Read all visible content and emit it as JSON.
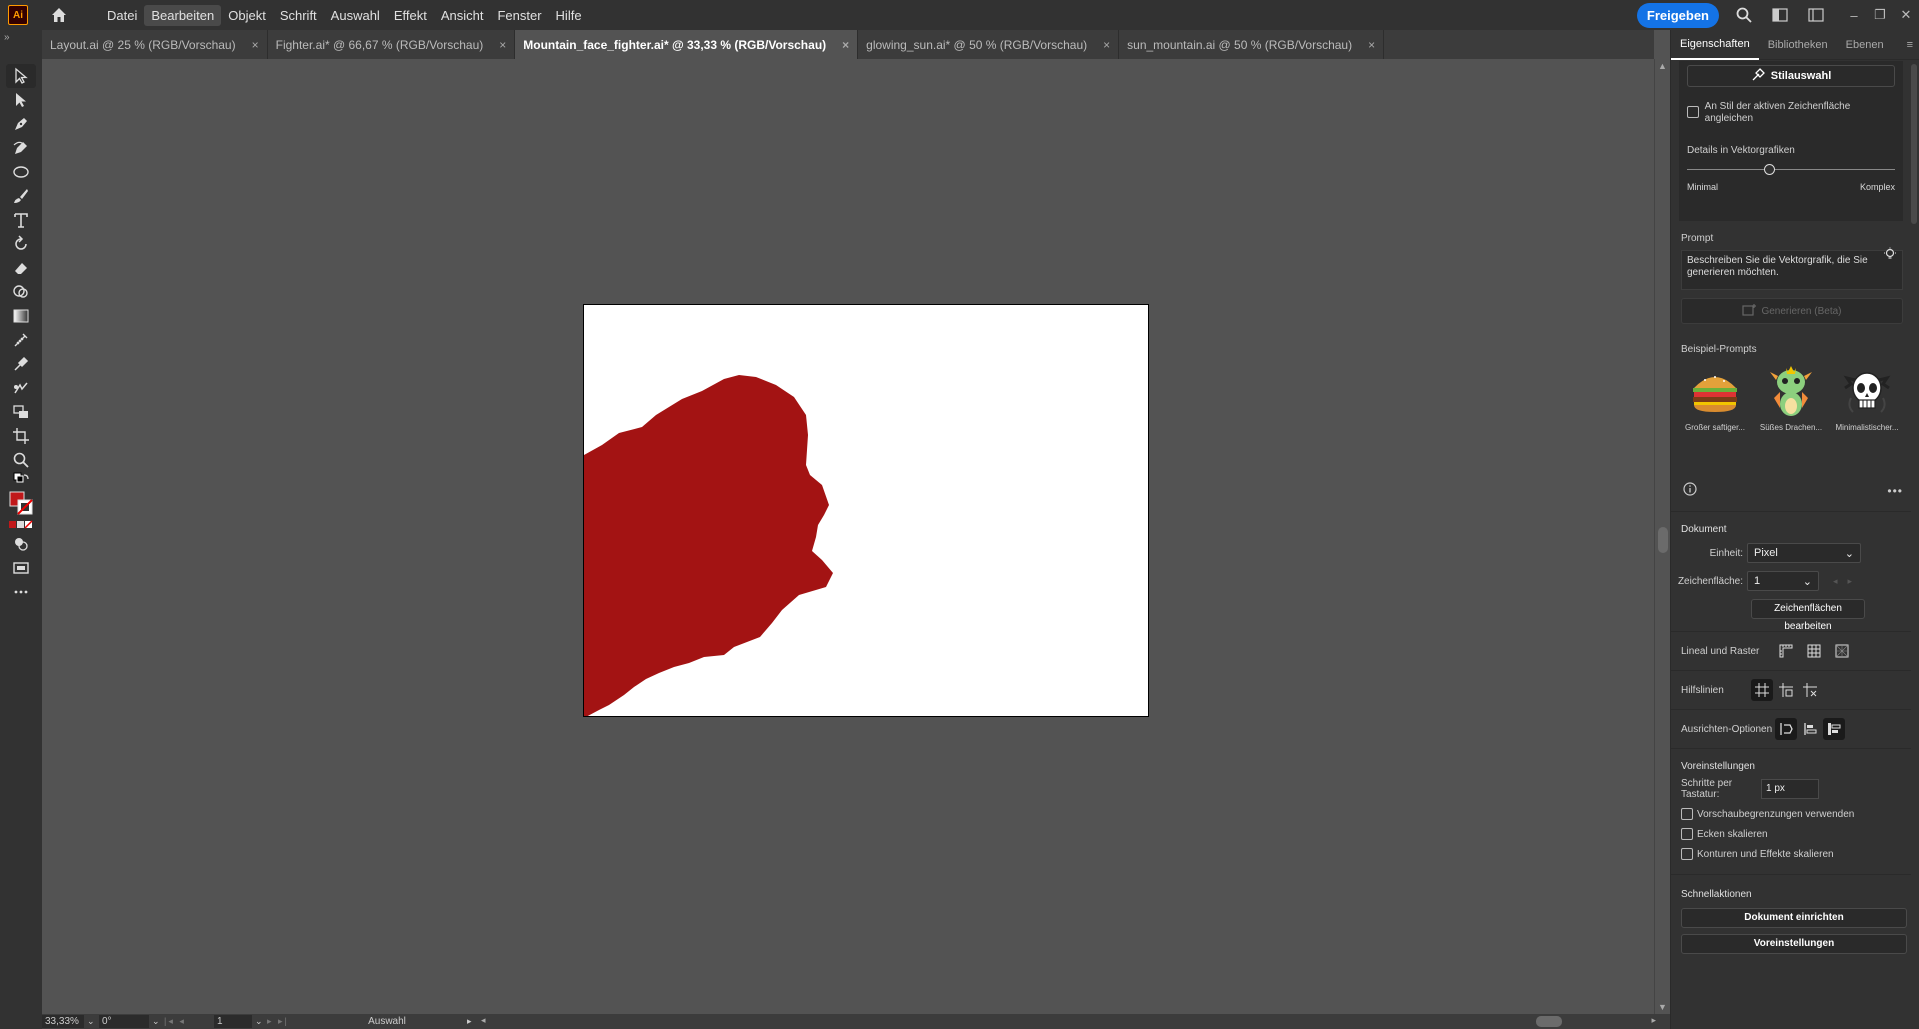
{
  "app": {
    "logo": "Ai"
  },
  "menu": [
    "Datei",
    "Bearbeiten",
    "Objekt",
    "Schrift",
    "Auswahl",
    "Effekt",
    "Ansicht",
    "Fenster",
    "Hilfe"
  ],
  "share_label": "Freigeben",
  "tabs": [
    {
      "label": "Layout.ai @ 25 % (RGB/Vorschau)"
    },
    {
      "label": "Fighter.ai* @ 66,67 % (RGB/Vorschau)"
    },
    {
      "label": "Mountain_face_fighter.ai* @ 33,33 % (RGB/Vorschau)"
    },
    {
      "label": "glowing_sun.ai* @ 50 % (RGB/Vorschau)"
    },
    {
      "label": "sun_mountain.ai @ 50 % (RGB/Vorschau)"
    }
  ],
  "tab_close": "×",
  "colors": {
    "shape_fill": "#a31313",
    "accent": "#1473e6",
    "fill_swatch": "#c0181a"
  },
  "status": {
    "zoom": "33,33%",
    "rotation": "0°",
    "artboard": "1",
    "tool": "Auswahl"
  },
  "panel": {
    "tabs": [
      "Eigenschaften",
      "Bibliotheken",
      "Ebenen"
    ],
    "style_button": "Stilauswahl",
    "match_style": "An Stil der aktiven Zeichenfläche angleichen",
    "vector_detail_title": "Details in Vektorgrafiken",
    "detail_min": "Minimal",
    "detail_max": "Komplex",
    "detail_level": 0.5,
    "prompt_title": "Prompt",
    "prompt_placeholder": "Beschreiben Sie die Vektorgrafik, die Sie generieren möchten.",
    "generate_button": "Generieren (Beta)",
    "examples_title": "Beispiel-Prompts",
    "examples": [
      {
        "label": "Großer saftiger...",
        "icon": "burger-icon"
      },
      {
        "label": "Süßes Drachen...",
        "icon": "dragon-icon"
      },
      {
        "label": "Minimalistischer...",
        "icon": "skull-icon"
      }
    ],
    "document_title": "Dokument",
    "unit_label": "Einheit:",
    "unit_value": "Pixel",
    "artboard_label": "Zeichenfläche:",
    "artboard_value": "1",
    "edit_artboards": "Zeichenflächen bearbeiten",
    "rulers_label": "Lineal und Raster",
    "guides_label": "Hilfslinien",
    "align_label": "Ausrichten-Optionen",
    "prefs_title": "Voreinstellungen",
    "keyboard_step_label": "Schritte per Tastatur:",
    "keyboard_step_value": "1 px",
    "preview_bounds": "Vorschaubegrenzungen verwenden",
    "scale_corners": "Ecken skalieren",
    "scale_strokes": "Konturen und Effekte skalieren",
    "quick_actions_title": "Schnellaktionen",
    "doc_setup": "Dokument einrichten",
    "preferences": "Voreinstellungen"
  }
}
